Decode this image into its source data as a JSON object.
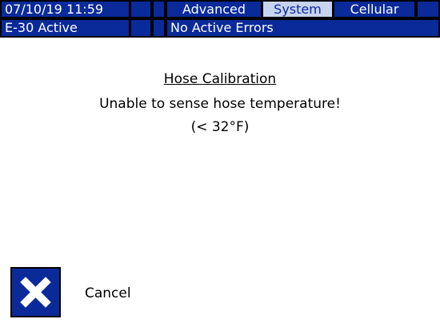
{
  "status_bar": {
    "datetime": "07/10/19 11:59",
    "tabs": [
      {
        "label": "Advanced",
        "selected": false
      },
      {
        "label": "System",
        "selected": true
      },
      {
        "label": "Cellular",
        "selected": false
      }
    ]
  },
  "error_bar": {
    "active_event": "E-30 Active",
    "error_message": "No Active Errors"
  },
  "dialog": {
    "title": "Hose Calibration",
    "message": "Unable to sense hose temperature!",
    "detail": "(< 32°F)"
  },
  "actions": {
    "cancel_label": "Cancel",
    "cancel_icon": "x-icon"
  },
  "colors": {
    "bar_blue": "#0a2a9a",
    "selected_tab": "#c8d3ef",
    "background": "#ffffff"
  }
}
